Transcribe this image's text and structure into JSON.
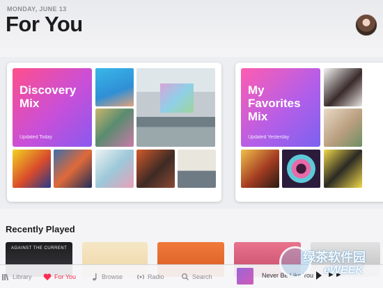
{
  "header": {
    "date": "MONDAY, JUNE 13",
    "title": "For You"
  },
  "mixes": [
    {
      "title": "Discovery Mix",
      "subtitle": "Updated Today"
    },
    {
      "title": "My Favorites Mix",
      "subtitle": "Updated Yesterday"
    }
  ],
  "recently_played": {
    "title": "Recently Played",
    "items": [
      {
        "cover_text": "AGAINST THE CURRENT"
      },
      {
        "cover_text": ""
      },
      {
        "cover_text": ""
      },
      {
        "cover_text": ""
      },
      {
        "cover_text": ""
      }
    ]
  },
  "tabbar": {
    "tabs": [
      {
        "label": "Library",
        "icon": "library-icon"
      },
      {
        "label": "For You",
        "icon": "heart-icon",
        "active": true
      },
      {
        "label": "Browse",
        "icon": "music-note-icon"
      },
      {
        "label": "Radio",
        "icon": "radio-icon"
      },
      {
        "label": "Search",
        "icon": "search-icon"
      }
    ],
    "now_playing": "Never Be Like You"
  },
  "watermark": {
    "text": "绿茶软件园",
    "sub": "eWEEK"
  },
  "colors": {
    "accent": "#fa2d55",
    "text_primary": "#1c1c1e",
    "text_secondary": "#8e8e93"
  }
}
